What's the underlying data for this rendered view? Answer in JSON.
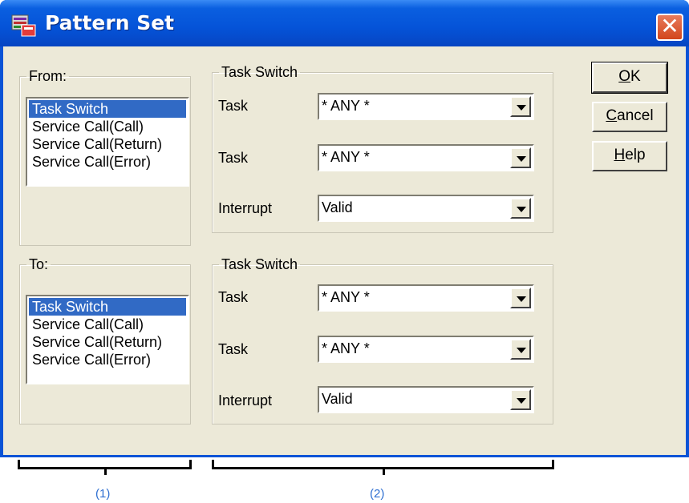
{
  "dialog": {
    "title": "Pattern Set",
    "close_label": "✕"
  },
  "from_group": {
    "legend": "From:",
    "items": [
      "Task Switch",
      "Service Call(Call)",
      "Service Call(Return)",
      "Service Call(Error)"
    ],
    "selected": "Task Switch"
  },
  "to_group": {
    "legend": "To:",
    "items": [
      "Task Switch",
      "Service Call(Call)",
      "Service Call(Return)",
      "Service Call(Error)"
    ],
    "selected": "Task Switch"
  },
  "from_detail": {
    "legend": "Task Switch",
    "rows": [
      {
        "label": "Task",
        "value": "* ANY *"
      },
      {
        "label": "Task",
        "value": "* ANY *"
      },
      {
        "label": "Interrupt",
        "value": "Valid"
      }
    ]
  },
  "to_detail": {
    "legend": "Task Switch",
    "rows": [
      {
        "label": "Task",
        "value": "* ANY *"
      },
      {
        "label": "Task",
        "value": "* ANY *"
      },
      {
        "label": "Interrupt",
        "value": "Valid"
      }
    ]
  },
  "buttons": {
    "ok": {
      "accel": "O",
      "rest": "K"
    },
    "cancel": {
      "accel": "C",
      "rest": "ancel"
    },
    "help": {
      "accel": "H",
      "rest": "elp"
    }
  },
  "callouts": {
    "left": "(1)",
    "right": "(2)"
  }
}
